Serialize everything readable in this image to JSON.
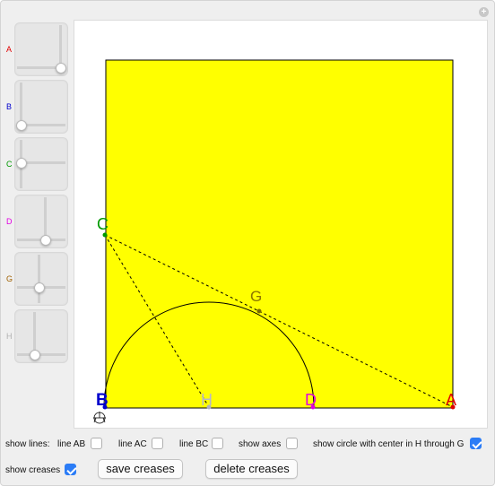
{
  "sliders": [
    {
      "label": "A",
      "color": "#e00000",
      "knob": [
        0.88,
        0.84
      ]
    },
    {
      "label": "B",
      "color": "#0000cc",
      "knob": [
        0.1,
        0.84
      ]
    },
    {
      "label": "C",
      "color": "#009900",
      "knob": [
        0.1,
        0.46
      ]
    },
    {
      "label": "D",
      "color": "#e000e0",
      "knob": [
        0.55,
        0.84
      ]
    },
    {
      "label": "G",
      "color": "#a06000",
      "knob": [
        0.45,
        0.65
      ]
    },
    {
      "label": "H",
      "color": "#b0b0b0",
      "knob": [
        0.35,
        0.84
      ]
    }
  ],
  "points": {
    "A": {
      "label": "A",
      "color": "#e00000"
    },
    "B": {
      "label": "B",
      "color": "#0000cc"
    },
    "C": {
      "label": "C",
      "color": "#009900"
    },
    "D": {
      "label": "D",
      "color": "#e000e0"
    },
    "G": {
      "label": "G",
      "color": "#8b7500"
    },
    "H": {
      "label": "H",
      "color": "#b8b8c8"
    }
  },
  "paper_color": "#ffff00",
  "controls": {
    "show_lines_label": "show lines:",
    "line_ab": {
      "label": "line AB",
      "checked": false
    },
    "line_ac": {
      "label": "line AC",
      "checked": false
    },
    "line_bc": {
      "label": "line BC",
      "checked": false
    },
    "show_axes": {
      "label": "show axes",
      "checked": false
    },
    "show_circle": {
      "label": "show circle with center in H through G",
      "checked": true
    },
    "show_creases": {
      "label": "show creases",
      "checked": true
    },
    "save_creases_label": "save creases",
    "delete_creases_label": "delete creases"
  },
  "accent_color": "#2b7cf6"
}
